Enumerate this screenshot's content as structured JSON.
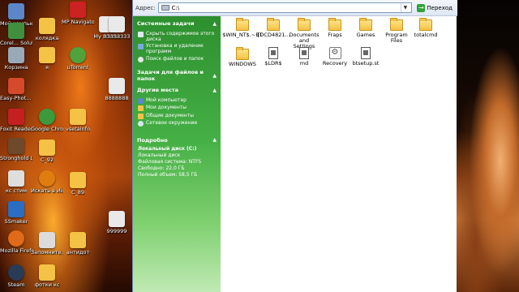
{
  "desktop": {
    "icons": [
      {
        "label": "Мой компьютер",
        "color": "#5b86c7"
      },
      {
        "label": "Corel... Solution",
        "color": "#3f8f3f"
      },
      {
        "label": "Корзина",
        "color": "#9aa9b8"
      },
      {
        "label": "Easy-Phot... EX",
        "color": "#d44a2a"
      },
      {
        "label": "Foxit Reader",
        "color": "#c42020"
      },
      {
        "label": "Stronghold Legends",
        "color": "#6e4a2a"
      },
      {
        "label": "кс стим",
        "color": "#dedede"
      },
      {
        "label": "SSmaker",
        "color": "#2b6dc2"
      },
      {
        "label": "Mozilla Firefox",
        "color": "#e06a18"
      },
      {
        "label": "Steam",
        "color": "#2a3b58"
      },
      {
        "label": "колядка",
        "color": "#f4c245"
      },
      {
        "label": "я",
        "color": "#f4c245"
      },
      {
        "label": "Google Chrome",
        "color": "#3b9a3b"
      },
      {
        "label": "C_92",
        "color": "#f4c245"
      },
      {
        "label": "Искать в Интернете",
        "color": "#e07d10"
      },
      {
        "label": "Запомните, навсегда",
        "color": "#dcdcdc"
      },
      {
        "label": "фотки кс",
        "color": "#f4c245"
      },
      {
        "label": "MP Navigator",
        "color": "#cc2222"
      },
      {
        "label": "uTorrent",
        "color": "#4fa33a"
      },
      {
        "label": "vsetainfo",
        "color": "#f4c245"
      },
      {
        "label": "C_89",
        "color": "#f4c245"
      },
      {
        "label": "антидот",
        "color": "#f4c245"
      },
      {
        "label": "My Printer",
        "color": "#e9e9e9"
      },
      {
        "label": "33333333",
        "color": "#e9e9e9"
      },
      {
        "label": "999999",
        "color": "#e9e9e9"
      },
      {
        "label": "8888888",
        "color": "#e9e9e9"
      }
    ]
  },
  "explorer": {
    "address": {
      "label": "Адрес:",
      "value": "C:\\",
      "go_label": "Переход"
    },
    "taskpane": {
      "system_tasks": {
        "title": "Системные задачи",
        "items": [
          "Скрыть содержимое этого диска",
          "Установка и удаление программ",
          "Поиск файлов и папок"
        ]
      },
      "file_tasks": {
        "title": "Задачи для файлов и папок"
      },
      "other_places": {
        "title": "Другие места",
        "items": [
          "Мой компьютер",
          "Мои документы",
          "Общие документы",
          "Сетевое окружение"
        ]
      },
      "details": {
        "title": "Подробно",
        "name": "Локальный диск (C:)",
        "type": "Локальный диск",
        "fs": "Файловая система: NTFS",
        "free": "Свободно: 22,0 ГБ",
        "total": "Полный объем: 58,5 ГБ"
      }
    },
    "files": [
      {
        "name": "$WIN_NT$.~BT",
        "kind": "folder"
      },
      {
        "name": "{DCD4821...",
        "kind": "folder"
      },
      {
        "name": "Documents and Settings",
        "kind": "folder"
      },
      {
        "name": "Fraps",
        "kind": "folder"
      },
      {
        "name": "Games",
        "kind": "folder"
      },
      {
        "name": "Program Files",
        "kind": "folder"
      },
      {
        "name": "totalcmd",
        "kind": "folder"
      },
      {
        "name": "WINDOWS",
        "kind": "folder"
      },
      {
        "name": "$LDR$",
        "kind": "doc"
      },
      {
        "name": "md",
        "kind": "doc"
      },
      {
        "name": "Recovery",
        "kind": "gear"
      },
      {
        "name": "btsetup.st",
        "kind": "doc"
      }
    ]
  }
}
